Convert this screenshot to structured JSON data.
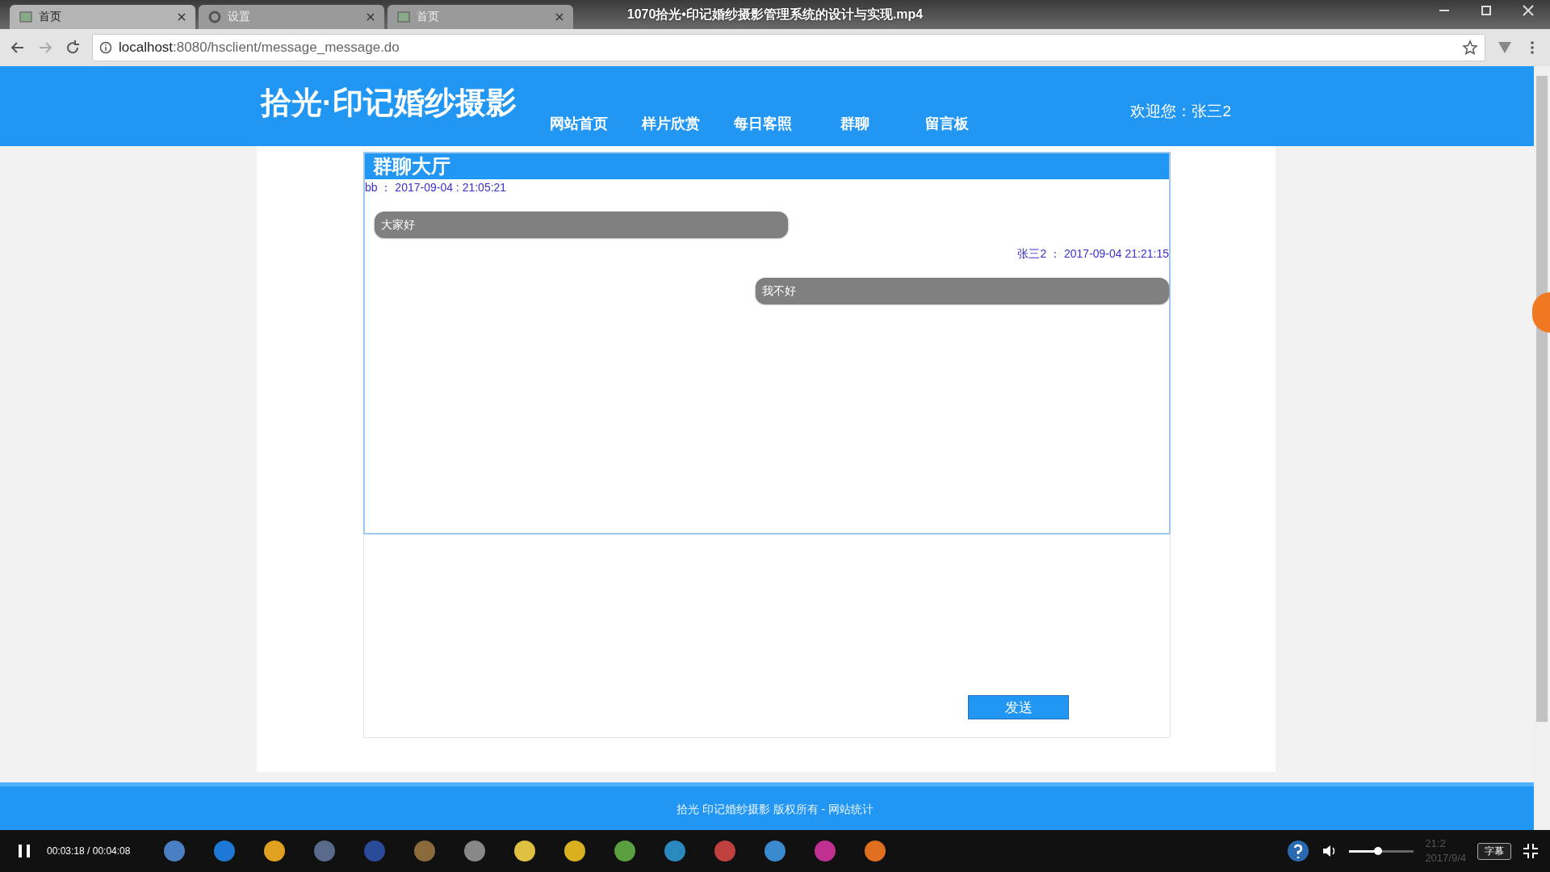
{
  "browser": {
    "tabs": [
      {
        "label": "首页",
        "selected": true
      },
      {
        "label": "设置",
        "selected": false
      },
      {
        "label": "首页",
        "selected": false
      }
    ],
    "url_host": "localhost",
    "url_rest": ":8080/hsclient/message_message.do"
  },
  "video_title": "1070拾光•印记婚纱摄影管理系统的设计与实现.mp4",
  "site": {
    "logo": "拾光·印记婚纱摄影",
    "nav": [
      "网站首页",
      "样片欣赏",
      "每日客照",
      "群聊",
      "留言板"
    ],
    "welcome": "欢迎您：张三2"
  },
  "chat": {
    "title": "群聊大厅",
    "messages": [
      {
        "kind": "incoming",
        "meta": "bb ： 2017-09-04 : 21:05:21",
        "text": "大家好"
      },
      {
        "kind": "outgoing",
        "meta": "张三2 ： 2017-09-04 21:21:15",
        "text": "我不好"
      }
    ]
  },
  "composer": {
    "button": "发送"
  },
  "footer": "拾光 印记婚纱摄影 版权所有 - 网站统计",
  "player": {
    "time": "00:03:18 / 00:04:08",
    "volume": {
      "level": 0.45
    },
    "subtitle_button": "字幕",
    "clock_time": "21:2",
    "clock_date": "2017/9/4"
  }
}
